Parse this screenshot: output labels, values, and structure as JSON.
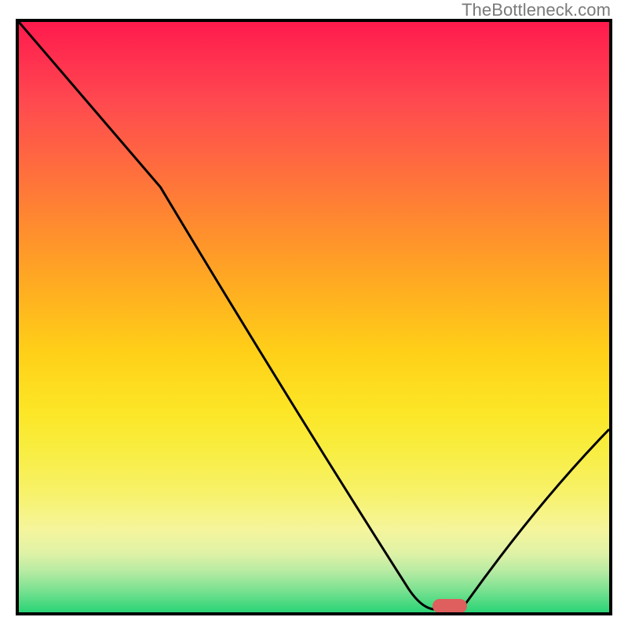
{
  "watermark": "TheBottleneck.com",
  "chart_data": {
    "type": "line",
    "title": "",
    "xlabel": "",
    "ylabel": "",
    "xlim": [
      0,
      100
    ],
    "ylim": [
      0,
      100
    ],
    "grid": false,
    "legend": false,
    "series": [
      {
        "name": "curve",
        "x": [
          0,
          24,
          66,
          71,
          75,
          100
        ],
        "y": [
          100,
          72,
          4,
          0.5,
          0.5,
          31
        ]
      }
    ],
    "marker": {
      "x": 73,
      "y": 0.8,
      "color": "#df5e5e"
    },
    "background_gradient_stops": [
      {
        "pos": 0,
        "color": "#ff1a4d"
      },
      {
        "pos": 24,
        "color": "#ff6a3f"
      },
      {
        "pos": 46,
        "color": "#ffb020"
      },
      {
        "pos": 66,
        "color": "#fce626"
      },
      {
        "pos": 86,
        "color": "#f5f59c"
      },
      {
        "pos": 100,
        "color": "#2ad476"
      }
    ]
  }
}
